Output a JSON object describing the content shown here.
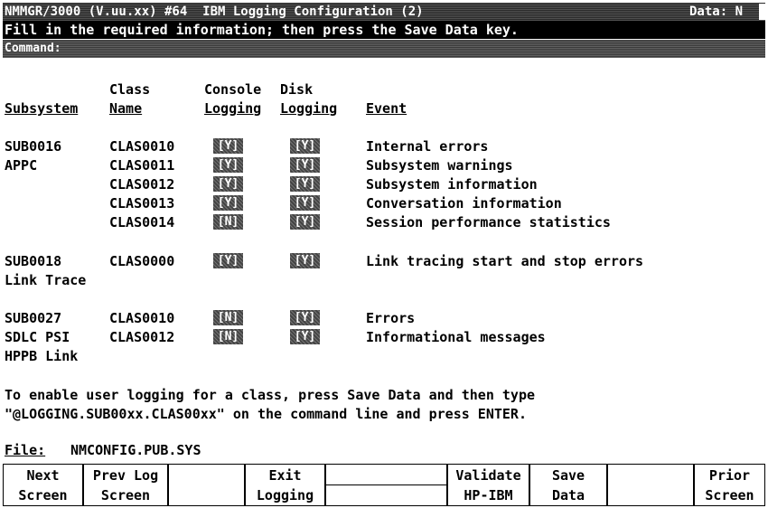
{
  "header": {
    "title": "NMMGR/3000 (V.uu.xx) #64  IBM Logging Configuration (2)",
    "data_indicator": "Data: N"
  },
  "instruction": "Fill in the required information; then press the Save Data key.",
  "command": {
    "label": "Command:",
    "value": ""
  },
  "columns": {
    "class_top": "Class",
    "console_top": "Console",
    "disk_top": "Disk",
    "subsystem": "Subsystem",
    "class_name": "Name",
    "console_logging": "Logging",
    "disk_logging": "Logging",
    "event": "Event"
  },
  "subsystems": [
    {
      "sub": "SUB0016",
      "desc": [
        "APPC"
      ],
      "rows": [
        {
          "class": "CLAS0010",
          "console": "[Y]",
          "disk": "[Y]",
          "event": "Internal errors"
        },
        {
          "class": "CLAS0011",
          "console": "[Y]",
          "disk": "[Y]",
          "event": "Subsystem warnings"
        },
        {
          "class": "CLAS0012",
          "console": "[Y]",
          "disk": "[Y]",
          "event": "Subsystem information"
        },
        {
          "class": "CLAS0013",
          "console": "[Y]",
          "disk": "[Y]",
          "event": "Conversation information"
        },
        {
          "class": "CLAS0014",
          "console": "[N]",
          "disk": "[Y]",
          "event": "Session performance statistics"
        }
      ]
    },
    {
      "sub": "SUB0018",
      "desc": [
        "Link Trace"
      ],
      "rows": [
        {
          "class": "CLAS0000",
          "console": "[Y]",
          "disk": "[Y]",
          "event": "Link tracing start and stop errors"
        }
      ]
    },
    {
      "sub": "SUB0027",
      "desc": [
        "SDLC PSI",
        "HPPB Link"
      ],
      "rows": [
        {
          "class": "CLAS0010",
          "console": "[N]",
          "disk": "[Y]",
          "event": "Errors"
        },
        {
          "class": "CLAS0012",
          "console": "[N]",
          "disk": "[Y]",
          "event": "Informational messages"
        }
      ]
    }
  ],
  "footer_note": [
    "To enable user logging for a class, press Save Data and then type",
    "\"@LOGGING.SUB00xx.CLAS00xx\" on the command line and press ENTER."
  ],
  "file": {
    "label": "File:",
    "value": "NMCONFIG.PUB.SYS"
  },
  "function_keys": [
    {
      "l1": "Next",
      "l2": "Screen"
    },
    {
      "l1": "Prev Log",
      "l2": "Screen"
    },
    {
      "l1": "",
      "l2": ""
    },
    {
      "l1": "Exit",
      "l2": "Logging"
    },
    {
      "l1": "",
      "l2": ""
    },
    {
      "l1": "Validate",
      "l2": "HP-IBM"
    },
    {
      "l1": "Save",
      "l2": "Data"
    },
    {
      "l1": "",
      "l2": ""
    },
    {
      "l1": "Prior",
      "l2": "Screen"
    }
  ]
}
